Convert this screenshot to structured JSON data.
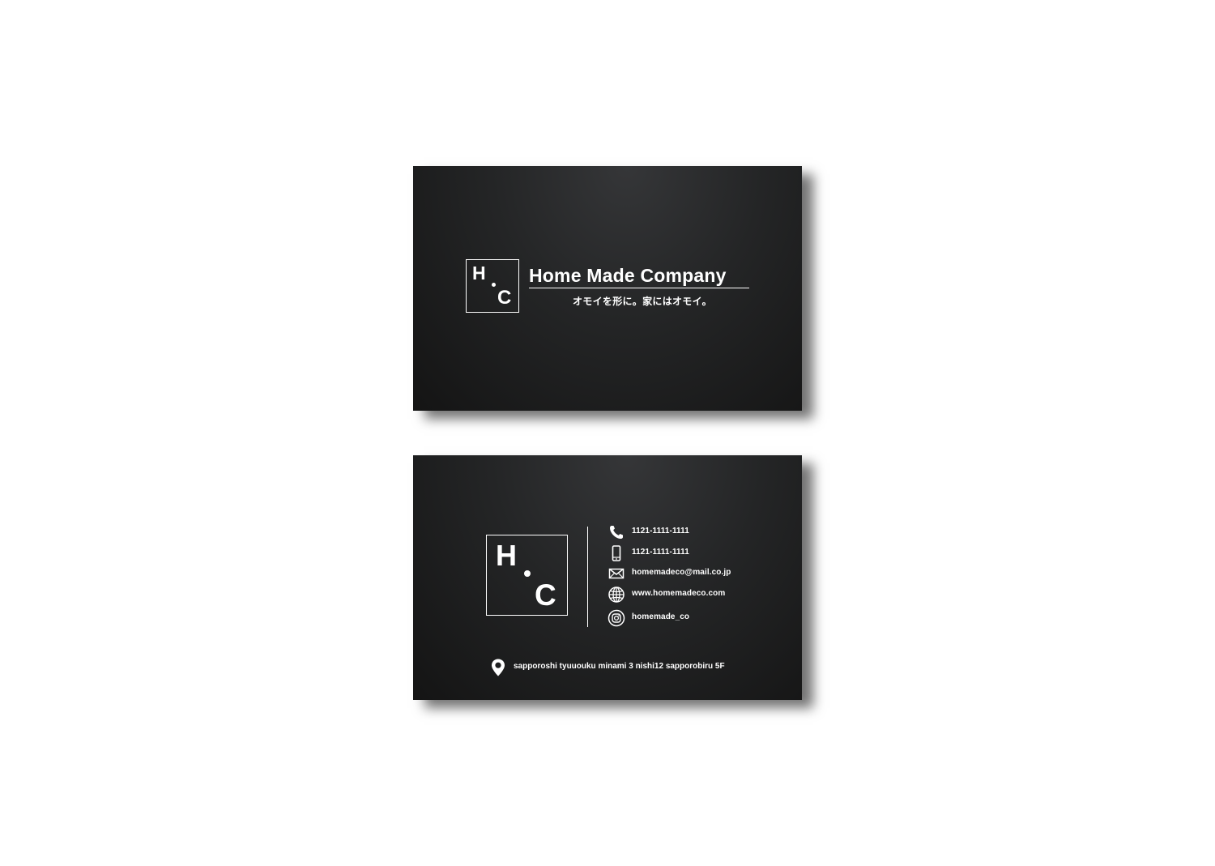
{
  "front": {
    "logo": {
      "letter_h": "H",
      "letter_c": "C"
    },
    "company_name": "Home Made Company",
    "tagline": "オモイを形に。家にはオモイ。"
  },
  "back": {
    "logo": {
      "letter_h": "H",
      "letter_c": "C"
    },
    "contacts": {
      "phone": {
        "icon": "phone-icon",
        "text": "1121-1111-1111"
      },
      "mobile": {
        "icon": "mobile-icon",
        "text": "1121-1111-1111"
      },
      "email": {
        "icon": "mail-icon",
        "text": "homemadeco@mail.co.jp"
      },
      "web": {
        "icon": "globe-icon",
        "text": "www.homemadeco.com"
      },
      "instagram": {
        "icon": "instagram-icon",
        "text": "homemade_co"
      }
    },
    "address": {
      "icon": "location-pin-icon",
      "text": "sapporoshi tyuuouku minami 3 nishi12 sapporobiru 5F"
    }
  },
  "colors": {
    "card_background": "#1c1d1e",
    "foreground": "#ffffff",
    "page_background": "#ffffff"
  }
}
